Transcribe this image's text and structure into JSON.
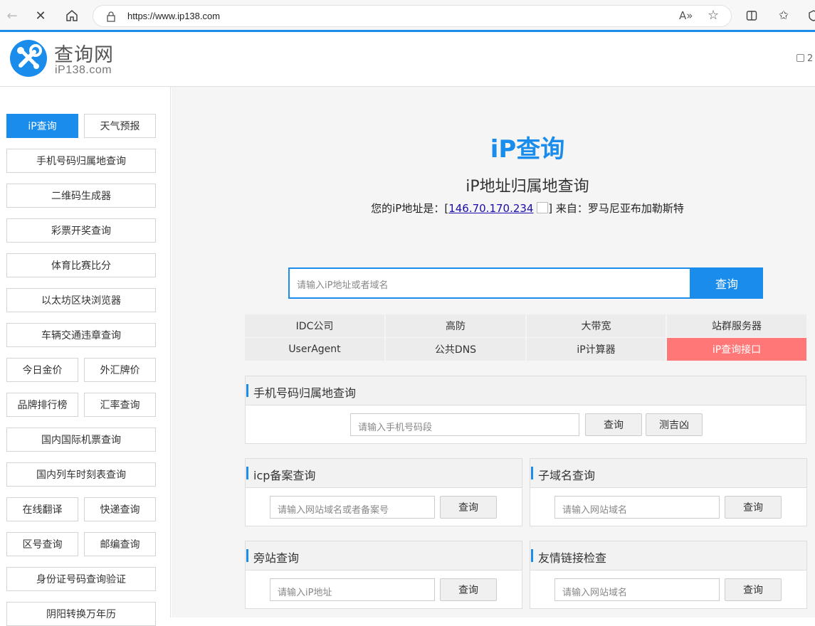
{
  "browser": {
    "url": "https://www.ip138.com"
  },
  "site": {
    "logo_title": "查询网",
    "logo_sub": "iP138.com",
    "date_partial": "2"
  },
  "sidebar": {
    "items": [
      {
        "label": "iP查询",
        "active": true
      },
      {
        "label": "天气预报"
      },
      {
        "label": "手机号码归属地查询"
      },
      {
        "label": "二维码生成器"
      },
      {
        "label": "彩票开奖查询"
      },
      {
        "label": "体育比赛比分"
      },
      {
        "label": "以太坊区块浏览器"
      },
      {
        "label": "车辆交通违章查询"
      },
      {
        "label": "今日金价"
      },
      {
        "label": "外汇牌价"
      },
      {
        "label": "品牌排行榜"
      },
      {
        "label": "汇率查询"
      },
      {
        "label": "国内国际机票查询"
      },
      {
        "label": "国内列车时刻表查询"
      },
      {
        "label": "在线翻译"
      },
      {
        "label": "快递查询"
      },
      {
        "label": "区号查询"
      },
      {
        "label": "邮编查询"
      },
      {
        "label": "身份证号码查询验证"
      },
      {
        "label": "阴阳转换万年历"
      }
    ]
  },
  "main": {
    "title": "iP查询",
    "subtitle": "iP地址归属地查询",
    "ip_prefix": "您的iP地址是：[",
    "ip_address": "146.70.170.234",
    "ip_suffix": "] 来自：罗马尼亚布加勒斯特",
    "search_placeholder": "请输入iP地址或者域名",
    "search_button": "查询",
    "grid": [
      {
        "label": "IDC公司"
      },
      {
        "label": "高防"
      },
      {
        "label": "大带宽"
      },
      {
        "label": "站群服务器"
      },
      {
        "label": "UserAgent"
      },
      {
        "label": "公共DNS"
      },
      {
        "label": "iP计算器"
      },
      {
        "label": "iP查询接口",
        "highlight": true
      }
    ],
    "panels": {
      "phone": {
        "title": "手机号码归属地查询",
        "placeholder": "请输入手机号码段",
        "button": "查询",
        "button2": "测吉凶"
      },
      "icp": {
        "title": "icp备案查询",
        "placeholder": "请输入网站域名或者备案号",
        "button": "查询"
      },
      "subdomain": {
        "title": "子域名查询",
        "placeholder": "请输入网站域名",
        "button": "查询"
      },
      "sidesite": {
        "title": "旁站查询",
        "placeholder": "请输入iP地址",
        "button": "查询"
      },
      "friendlink": {
        "title": "友情链接检查",
        "placeholder": "请输入网站域名",
        "button": "查询"
      }
    }
  },
  "colors": {
    "accent": "#1a8ceb",
    "highlight_cell": "#ff7777"
  }
}
